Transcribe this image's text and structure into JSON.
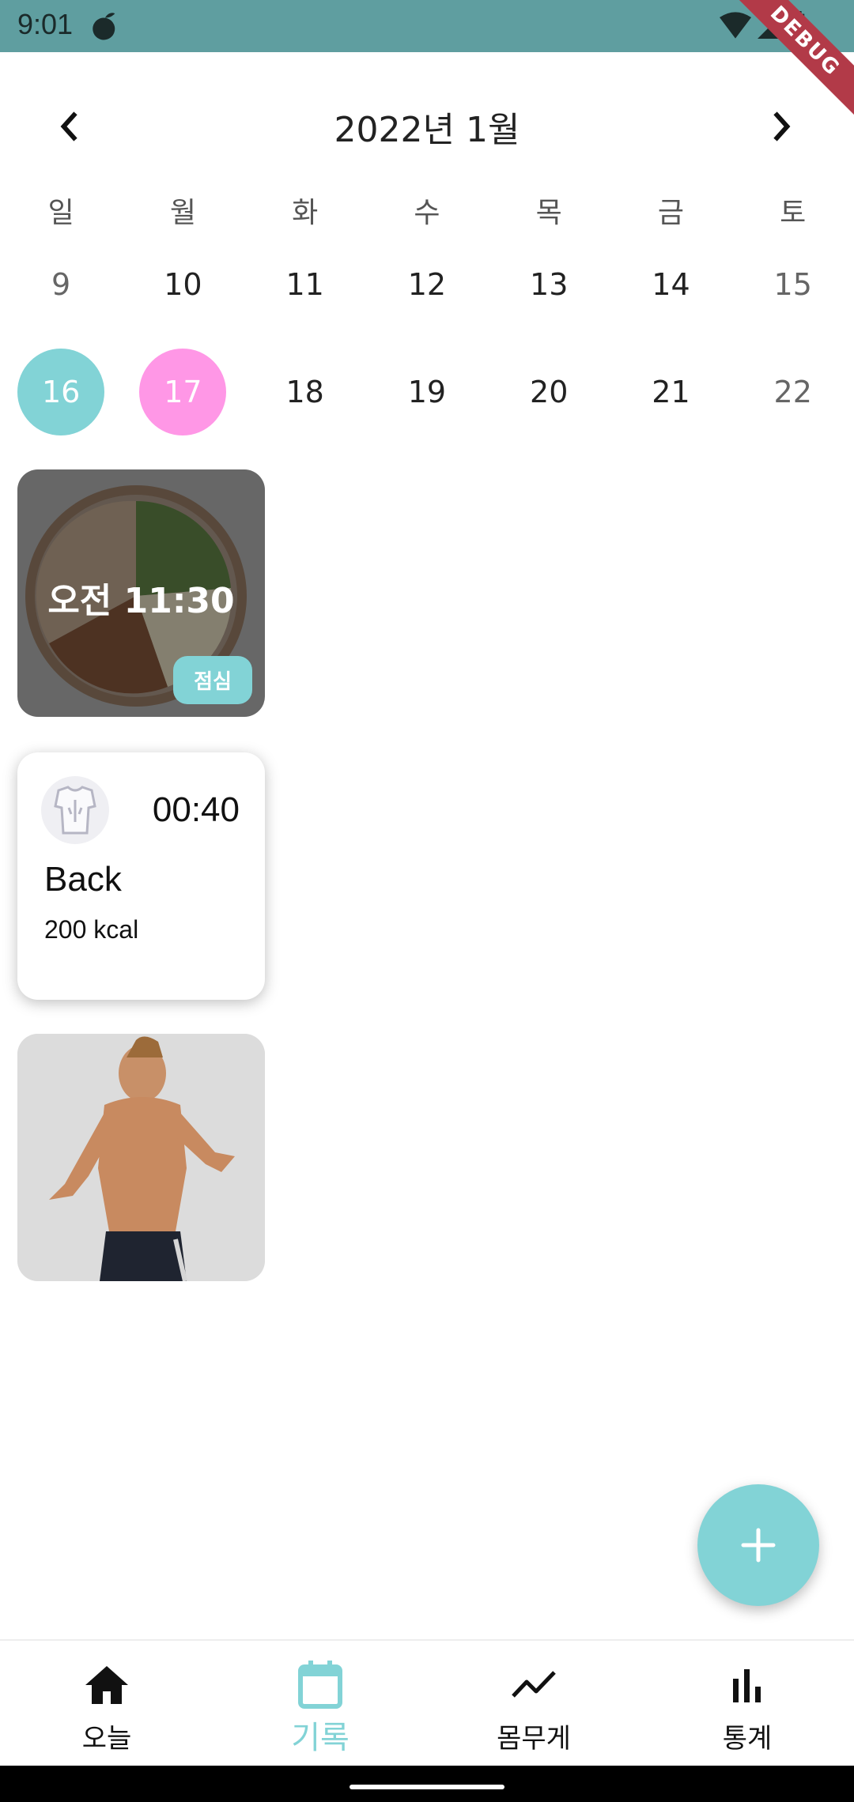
{
  "status_bar": {
    "time": "9:01",
    "debug_label": "DEBUG"
  },
  "calendar": {
    "month_title": "2022년 1월",
    "weekdays": [
      "일",
      "월",
      "화",
      "수",
      "목",
      "금",
      "토"
    ],
    "week1": [
      "9",
      "10",
      "11",
      "12",
      "13",
      "14",
      "15"
    ],
    "week2": [
      "16",
      "17",
      "18",
      "19",
      "20",
      "21",
      "22"
    ]
  },
  "meal_card": {
    "time": "오전 11:30",
    "badge": "점심"
  },
  "exercise_card": {
    "duration": "00:40",
    "name": "Back",
    "kcal": "200 kcal"
  },
  "bottom_nav": {
    "today": "오늘",
    "records": "기록",
    "weight": "몸무게",
    "stats": "통계"
  },
  "colors": {
    "accent": "#82d3d6",
    "pink": "#ff97e6",
    "status_bar": "#5f9ea0"
  }
}
